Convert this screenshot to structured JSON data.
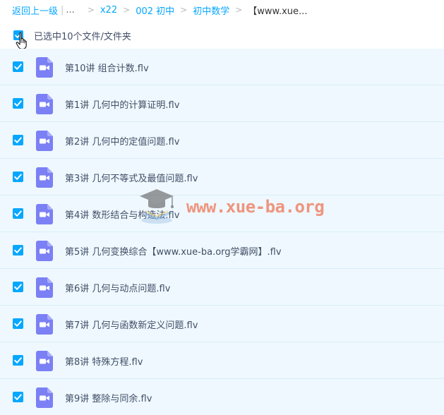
{
  "breadcrumb": {
    "back": "返回上一级",
    "separator": "|",
    "ellipsis": "...",
    "arrow": ">",
    "items": [
      "x22",
      "002 初中",
      "初中数学"
    ],
    "current": "【www.xue..."
  },
  "selection": {
    "text": "已选中10个文件/文件夹",
    "checked": true
  },
  "files": [
    {
      "name": "第10讲 组合计数.flv",
      "checked": true,
      "icon": "video-file-icon"
    },
    {
      "name": "第1讲 几何中的计算证明.flv",
      "checked": true,
      "icon": "video-file-icon"
    },
    {
      "name": "第2讲 几何中的定值问题.flv",
      "checked": true,
      "icon": "video-file-icon"
    },
    {
      "name": "第3讲 几何不等式及最值问题.flv",
      "checked": true,
      "icon": "video-file-icon"
    },
    {
      "name": "第4讲 数形结合与构造法.flv",
      "checked": true,
      "icon": "video-file-icon"
    },
    {
      "name": "第5讲 几何变换综合【www.xue-ba.org学霸网】.flv",
      "checked": true,
      "icon": "video-file-icon"
    },
    {
      "name": "第6讲 几何与动点问题.flv",
      "checked": true,
      "icon": "video-file-icon"
    },
    {
      "name": "第7讲 几何与函数新定义问题.flv",
      "checked": true,
      "icon": "video-file-icon"
    },
    {
      "name": "第8讲 特殊方程.flv",
      "checked": true,
      "icon": "video-file-icon"
    },
    {
      "name": "第9讲 整除与同余.flv",
      "checked": true,
      "icon": "video-file-icon"
    }
  ],
  "watermark": {
    "text": "www.xue-ba.org"
  },
  "colors": {
    "accent": "#06a7ff",
    "row_background": "#eef8fe",
    "video_icon": "#7b80f5",
    "text": "#424e67"
  }
}
